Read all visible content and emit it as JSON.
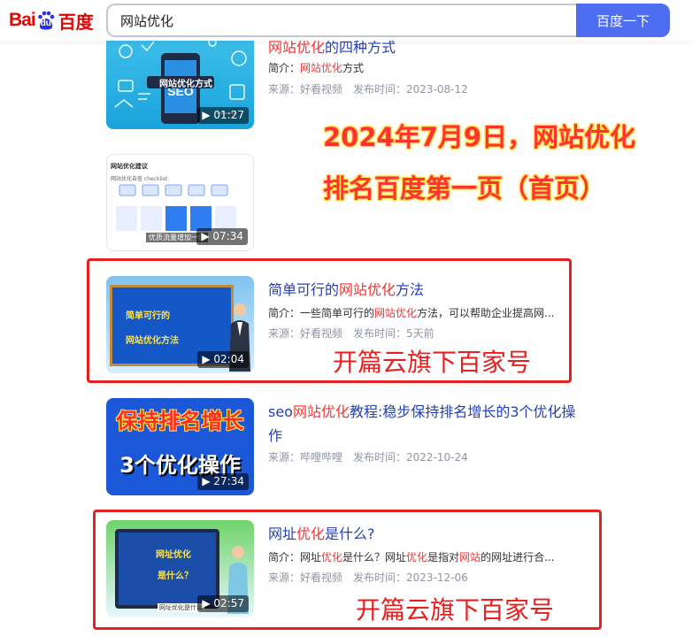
{
  "header": {
    "logo_latin": "Bai",
    "logo_du": "du",
    "logo_cn": "百度",
    "search_value": "网站优化",
    "search_button": "百度一下"
  },
  "overlay": {
    "banner_line1": "2024年7月9日，网站优化",
    "banner_line2": "排名百度第一页（首页）",
    "frame_label_1": "开篇云旗下百家号",
    "frame_label_2": "开篇云旗下百家号"
  },
  "results": [
    {
      "title_parts": [
        "",
        "网站优化",
        "的四种方式"
      ],
      "summary_parts": [
        "简介：",
        "网站优化",
        "方式",
        "",
        ""
      ],
      "source": "来源：好看视频",
      "published": "发布时间：2023-08-12",
      "duration": "01:27",
      "thumb_text": "网站优化方式"
    },
    {
      "duration": "07:34",
      "thumb_heading": "网站优化建议",
      "thumb_sub": "网站优化自查 checklist",
      "thumb_caption": "优质流量增加一倍"
    },
    {
      "title_parts": [
        "简单可行的",
        "网站优化",
        "方法"
      ],
      "summary_parts": [
        "简介：一些简单可行的",
        "网站优化",
        "方法，可以帮助企业提高网...",
        "",
        ""
      ],
      "source": "来源：好看视频",
      "published": "发布时间：5天前",
      "duration": "02:04",
      "thumb_line1": "简单可行的",
      "thumb_line2": "网站优化方法"
    },
    {
      "title_parts": [
        "seo",
        "网站优化",
        "教程:稳步保持排名增长的3个优化操作"
      ],
      "source": "来源：哔哩哔哩",
      "published": "发布时间：2022-10-24",
      "duration": "27:34",
      "thumb_line1": "保持排名增长",
      "thumb_line2": "3个优化操作"
    },
    {
      "title_parts": [
        "网址",
        "优化",
        "是什么?"
      ],
      "summary_parts": [
        "简介：网址",
        "优化",
        "是什么？网址",
        "优化",
        "是指对",
        "网站",
        "的网址进行合..."
      ],
      "source": "来源：好看视频",
      "published": "发布时间：2023-12-06",
      "duration": "02:57",
      "thumb_line1": "网址优化",
      "thumb_line2": "是什么？",
      "thumb_caption": "网址优化是什么"
    }
  ],
  "colors": {
    "link": "#2440b3",
    "highlight": "#f73131",
    "search_button": "#4e6ef2",
    "frame": "#e61f1f"
  }
}
